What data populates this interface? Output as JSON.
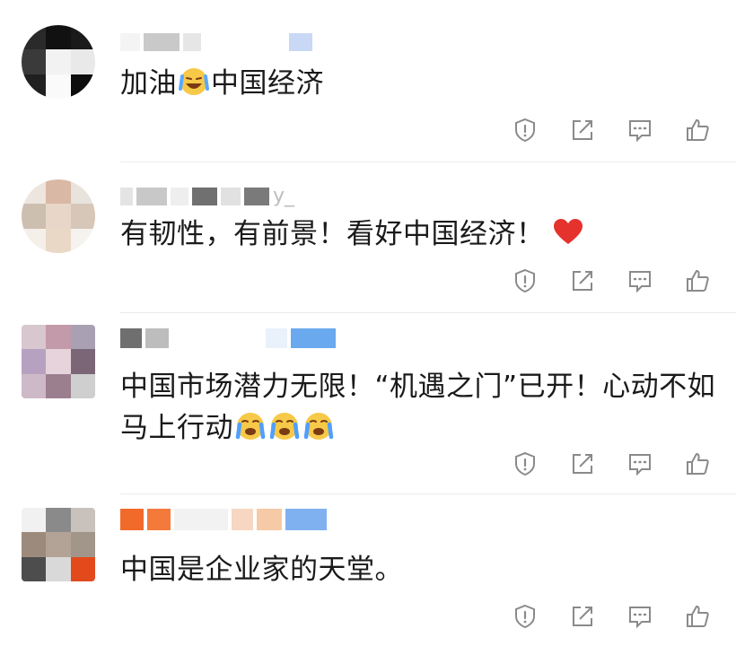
{
  "colors": {
    "text": "#1a1a1a",
    "icon": "#8a8a8a",
    "divider": "#ececec",
    "heart": "#e5322d"
  },
  "comments": [
    {
      "text_before": "加油",
      "emoji": "grinning-face-with-tears",
      "text_after": "中国经济"
    },
    {
      "username_fragment": "y_",
      "text": "有韧性，有前景！看好中国经济！",
      "emoji": "red-heart"
    },
    {
      "text_line1": "中国市场潜力无限！“机遇之门”已开！心动不如",
      "text_line2": "马上行动",
      "emoji": "face-with-tears"
    },
    {
      "text": "中国是企业家的天堂。"
    }
  ],
  "action_icons": [
    "report-icon",
    "share-icon",
    "reply-icon",
    "like-icon"
  ]
}
